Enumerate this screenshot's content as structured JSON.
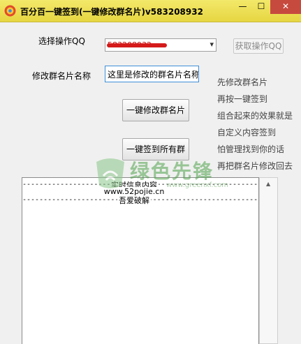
{
  "window": {
    "title": "百分百一键签到(一键修改群名片)v583208932",
    "min_label": "—",
    "max_label": "☐",
    "close_label": "✕"
  },
  "form": {
    "qq_label": "选择操作QQ",
    "qq_selected": "583208932",
    "get_qq_button": "获取操作QQ",
    "card_label": "修改群名片名称",
    "card_input_value": "这里是修改的群名片名称",
    "modify_button": "一键修改群名片",
    "signin_button": "一键签到所有群"
  },
  "hints": [
    "先修改群名片",
    "再按一键签到",
    "组合起来的效果就是",
    "自定义内容签到",
    "怕管理找到你的话",
    "再把群名片修改回去"
  ],
  "log": {
    "dashes1": "------------------------------------------------------------",
    "header": "实时信息内容",
    "url": "www.52pojie.cn",
    "dashes3": "------------------------------------------------------------",
    "footer": "吾爱破解"
  },
  "watermark": {
    "text": "绿色先锋",
    "url": "www.greenxf.com"
  },
  "colors": {
    "titlebar": "#e6d642",
    "close_button": "#c74a3f",
    "input_focus_border": "#3c8ed8",
    "watermark_green": "#4fa24b"
  }
}
